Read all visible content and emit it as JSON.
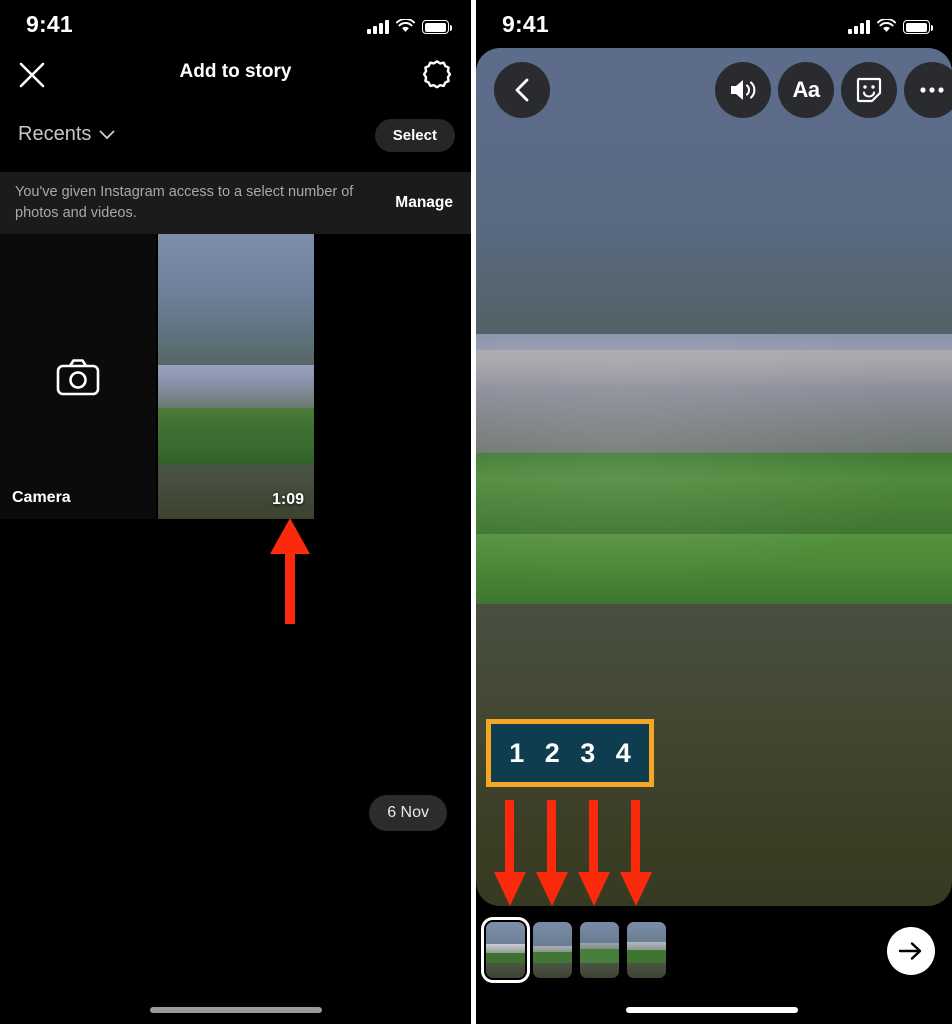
{
  "left_panel": {
    "statusbar": {
      "time": "9:41",
      "cellular": "signal-bars-icon",
      "wifi": "wifi-icon",
      "battery": "battery-icon"
    },
    "nav": {
      "close_icon": "close-icon",
      "title": "Add to story",
      "settings_icon": "gear-icon"
    },
    "filter": {
      "recents_label": "Recents",
      "chevron_icon": "chevron-down-icon",
      "select_label": "Select"
    },
    "permission": {
      "text": "You've given Instagram access to a select number of photos and videos.",
      "manage_label": "Manage"
    },
    "gallery": {
      "camera_label": "Camera",
      "camera_icon": "camera-icon",
      "photo_duration": "1:09"
    },
    "date_pill": "6 Nov",
    "annotation_arrow": "red-arrow-up"
  },
  "right_panel": {
    "statusbar": {
      "time": "9:41",
      "cellular": "signal-bars-icon",
      "wifi": "wifi-icon",
      "battery": "battery-icon"
    },
    "story_controls": {
      "back_icon": "chevron-left-icon",
      "audio_icon": "speaker-icon",
      "text_label": "Aa",
      "sticker_icon": "sticker-smiley-icon",
      "more_icon": "ellipsis-icon"
    },
    "number_badge": {
      "numbers": [
        "1",
        "2",
        "3",
        "4"
      ],
      "border_color": "#f5a623",
      "fill_color": "#0d3d4f"
    },
    "annotation_arrows": [
      "red-arrow-down",
      "red-arrow-down",
      "red-arrow-down",
      "red-arrow-down"
    ],
    "thumbnails": [
      {
        "index": "1",
        "selected": "true"
      },
      {
        "index": "2",
        "selected": "false"
      },
      {
        "index": "3",
        "selected": "false"
      },
      {
        "index": "4",
        "selected": "false"
      }
    ],
    "next_icon": "arrow-right-icon"
  },
  "colors": {
    "annotation_red": "#fb2a0c",
    "badge_orange": "#f5a623",
    "badge_teal": "#0d3d4f",
    "story_top": "#5c6c8b",
    "story_bottom": "#3b3d25"
  }
}
